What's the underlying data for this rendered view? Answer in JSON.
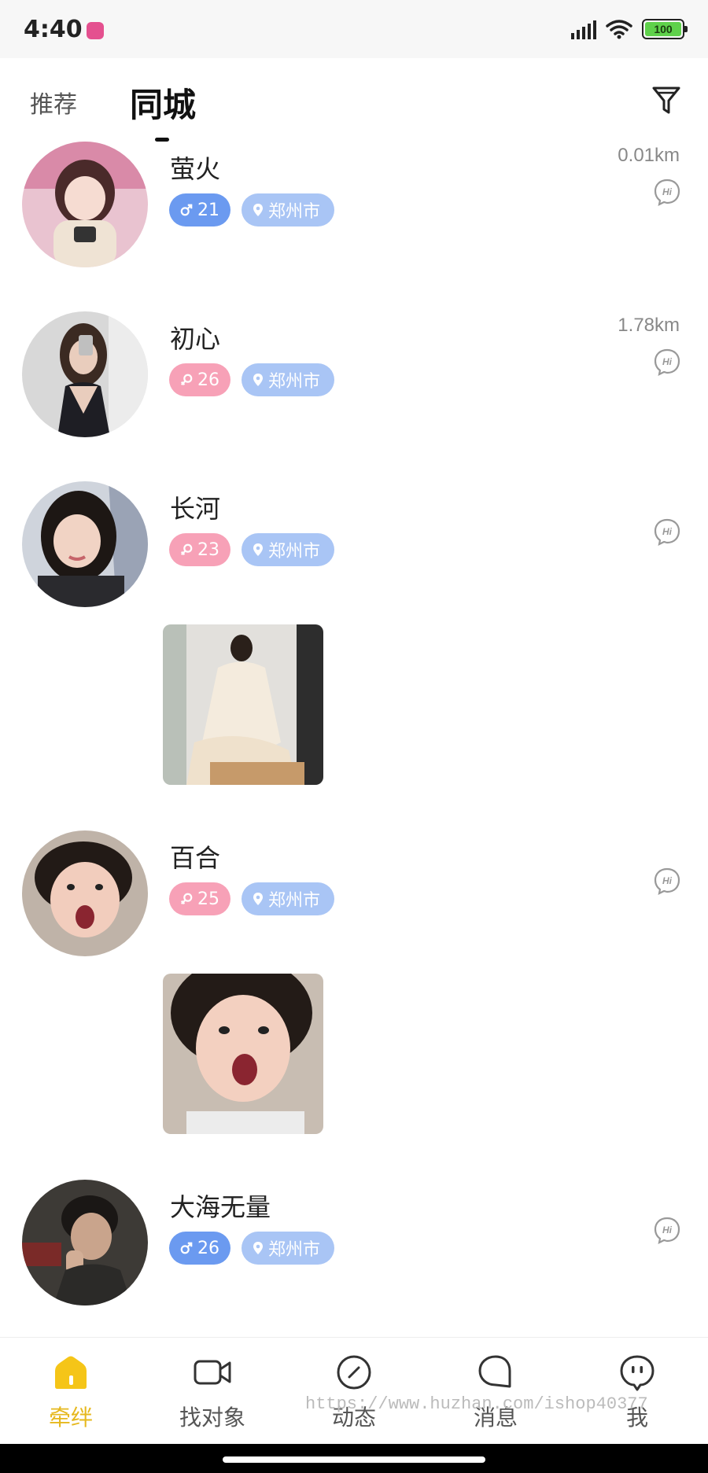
{
  "status_bar": {
    "time": "4:40",
    "battery": "100"
  },
  "header": {
    "tabs": [
      {
        "label": "推荐",
        "active": false
      },
      {
        "label": "同城",
        "active": true
      }
    ],
    "filter_icon": "filter-icon"
  },
  "users": [
    {
      "name": "萤火",
      "gender": "male",
      "age": "21",
      "city": "郑州市",
      "distance": "0.01km",
      "has_post_image": false
    },
    {
      "name": "初心",
      "gender": "female",
      "age": "26",
      "city": "郑州市",
      "distance": "1.78km",
      "has_post_image": false
    },
    {
      "name": "长河",
      "gender": "female",
      "age": "23",
      "city": "郑州市",
      "distance": "",
      "has_post_image": true
    },
    {
      "name": "百合",
      "gender": "female",
      "age": "25",
      "city": "郑州市",
      "distance": "",
      "has_post_image": true
    },
    {
      "name": "大海无量",
      "gender": "male",
      "age": "26",
      "city": "郑州市",
      "distance": "",
      "has_post_image": false
    }
  ],
  "bottom_nav": [
    {
      "label": "牵绊",
      "icon": "home-icon",
      "active": true
    },
    {
      "label": "找对象",
      "icon": "video-icon",
      "active": false
    },
    {
      "label": "动态",
      "icon": "compass-icon",
      "active": false
    },
    {
      "label": "消息",
      "icon": "chat-bubble-icon",
      "active": false
    },
    {
      "label": "我",
      "icon": "profile-face-icon",
      "active": false
    }
  ],
  "watermark": "https://www.huzhan.com/ishop40377",
  "colors": {
    "accent": "#e6b81e",
    "male_tag": "#6b9af0",
    "female_tag": "#f7a1b7",
    "city_tag": "#a9c5f5"
  }
}
